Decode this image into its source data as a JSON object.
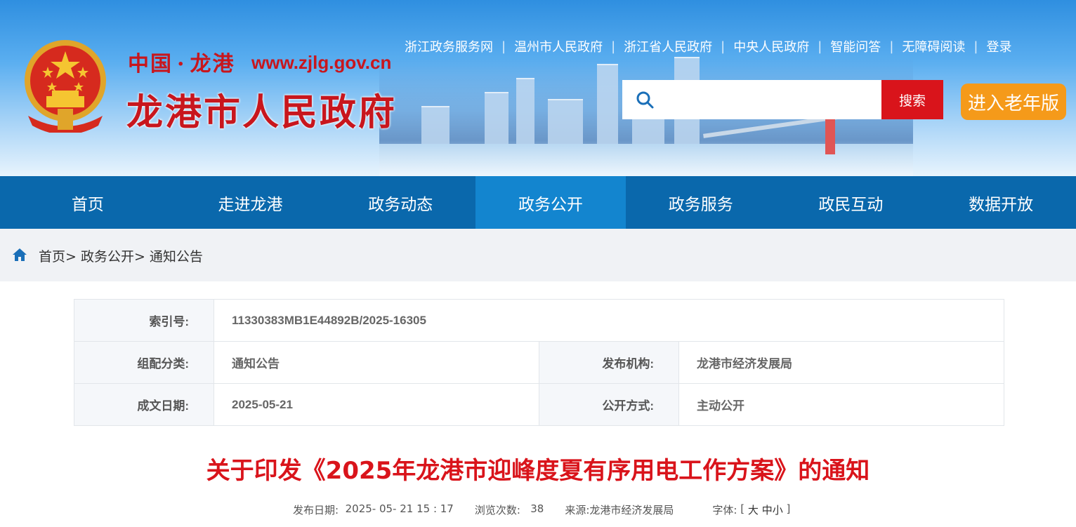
{
  "header": {
    "brand_cn": "中国",
    "brand_dot": "·",
    "brand_city": "龙港",
    "brand_url": "www.zjlg.gov.cn",
    "brand_title": "龙港市人民政府",
    "top_links": [
      "浙江政务服务网",
      "温州市人民政府",
      "浙江省人民政府",
      "中央人民政府",
      "智能问答",
      "无障碍阅读",
      "登录"
    ],
    "search_placeholder": "",
    "search_label": "搜索",
    "elder_label": "进入老年版"
  },
  "nav": {
    "items": [
      "首页",
      "走进龙港",
      "政务动态",
      "政务公开",
      "政务服务",
      "政民互动",
      "数据开放"
    ],
    "active": "政务公开"
  },
  "breadcrumb": "首页> 政务公开> 通知公告",
  "info": {
    "index_label": "索引号:",
    "index_value": "11330383MB1E44892B/2025-16305",
    "category_label": "组配分类:",
    "category_value": "通知公告",
    "publisher_label": "发布机构:",
    "publisher_value": "龙港市经济发展局",
    "date_label": "成文日期:",
    "date_value": "2025-05-21",
    "mode_label": "公开方式:",
    "mode_value": "主动公开"
  },
  "article": {
    "title": "关于印发《2025年龙港市迎峰度夏有序用电工作方案》的通知",
    "publish_label": "发布日期:",
    "publish_value": "2025- 05- 21 15 : 17",
    "views_label": "浏览次数:",
    "views_value": "38",
    "source_label": "来源:",
    "source_value": "龙港市经济发展局",
    "font_label": "字体:",
    "font_open": "[",
    "font_large": "大",
    "font_medium": "中",
    "font_small": "小",
    "font_close": "]"
  },
  "colors": {
    "nav_bg": "#0a68ac",
    "nav_active": "#1385cf",
    "brand_red": "#c8161d",
    "search_btn": "#d9141b",
    "elder_btn": "#f59a1a"
  }
}
